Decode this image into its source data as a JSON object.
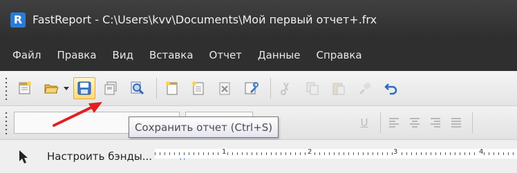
{
  "window": {
    "title": "FastReport - C:\\Users\\kvv\\Documents\\Мой первый отчет+.frx",
    "logo_letter": "R",
    "logo_color": "#2b7bd6"
  },
  "menu": {
    "items": [
      "Файл",
      "Правка",
      "Вид",
      "Вставка",
      "Отчет",
      "Данные",
      "Справка"
    ]
  },
  "toolbar": {
    "buttons": [
      {
        "name": "new-report-icon"
      },
      {
        "name": "open-icon"
      },
      {
        "name": "save-icon",
        "state": "hover"
      },
      {
        "name": "save-all-icon"
      },
      {
        "name": "preview-icon"
      },
      {
        "name": "new-page-icon"
      },
      {
        "name": "new-dialog-icon"
      },
      {
        "name": "delete-page-icon"
      },
      {
        "name": "page-setup-icon"
      },
      {
        "name": "cut-icon",
        "state": "disabled"
      },
      {
        "name": "copy-icon",
        "state": "disabled"
      },
      {
        "name": "paste-icon",
        "state": "disabled"
      },
      {
        "name": "format-painter-icon",
        "state": "disabled"
      },
      {
        "name": "undo-icon"
      }
    ]
  },
  "format_toolbar": {
    "underline_glyph": "U",
    "align_icons": [
      "align-left-icon",
      "align-center-icon",
      "align-right-icon",
      "justify-icon"
    ]
  },
  "tooltip": {
    "text": "Сохранить отчет (Ctrl+S)"
  },
  "annotation": {
    "arrow_color": "#e02020"
  },
  "bottom": {
    "configure_bands_label": "Настроить бэнды...",
    "ruler_labels": [
      "1",
      "2",
      "3",
      "4"
    ]
  },
  "colors": {
    "title_bg": "#3a3a3a",
    "hover_border": "#e0a83a"
  }
}
